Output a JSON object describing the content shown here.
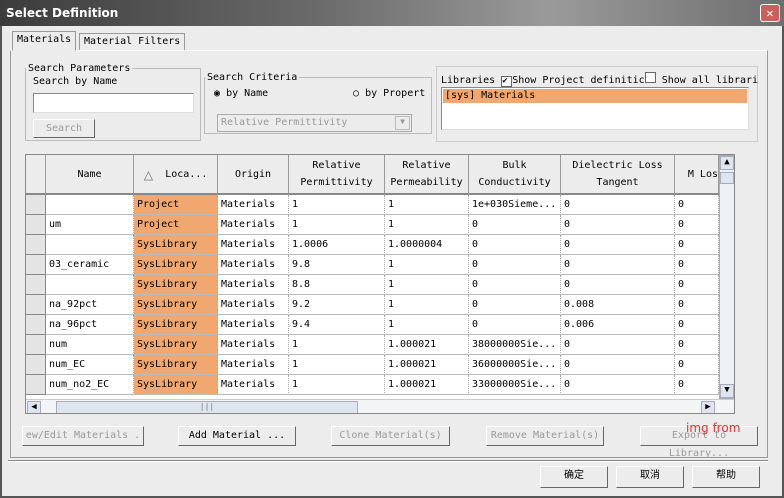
{
  "window": {
    "title": "Select Definition",
    "close_icon": "close-icon"
  },
  "tabs": [
    {
      "label": "Materials",
      "active": true
    },
    {
      "label": "Material Filters",
      "active": false
    }
  ],
  "search_parameters": {
    "legend": "Search Parameters",
    "label": "Search by Name",
    "value": "",
    "button": "Search"
  },
  "search_criteria": {
    "legend": "Search Criteria",
    "by_name": "by Name",
    "by_property": "by Propert",
    "selected": "by Name",
    "property_select": "Relative Permittivity"
  },
  "libraries": {
    "label": "Libraries",
    "show_project": "Show Project definitic",
    "show_project_checked": true,
    "show_all": "Show all librari",
    "show_all_checked": false,
    "items": [
      "[sys] Materials"
    ]
  },
  "table": {
    "columns": [
      "Name",
      "Loca...",
      "Origin",
      "Relative Permittivity",
      "Relative Permeability",
      "Bulk Conductivity",
      "Dielectric Loss Tangent",
      "M Los"
    ],
    "sort_column": "Loca...",
    "rows": [
      [
        "",
        "Project",
        "Materials",
        "1",
        "1",
        "1e+030Sieme...",
        "0",
        "0"
      ],
      [
        "um",
        "Project",
        "Materials",
        "1",
        "1",
        "0",
        "0",
        "0"
      ],
      [
        "",
        "SysLibrary",
        "Materials",
        "1.0006",
        "1.0000004",
        "0",
        "0",
        "0"
      ],
      [
        "03_ceramic",
        "SysLibrary",
        "Materials",
        "9.8",
        "1",
        "0",
        "0",
        "0"
      ],
      [
        "",
        "SysLibrary",
        "Materials",
        "8.8",
        "1",
        "0",
        "0",
        "0"
      ],
      [
        "na_92pct",
        "SysLibrary",
        "Materials",
        "9.2",
        "1",
        "0",
        "0.008",
        "0"
      ],
      [
        "na_96pct",
        "SysLibrary",
        "Materials",
        "9.4",
        "1",
        "0",
        "0.006",
        "0"
      ],
      [
        "num",
        "SysLibrary",
        "Materials",
        "1",
        "1.000021",
        "38000000Sie...",
        "0",
        "0"
      ],
      [
        "num_EC",
        "SysLibrary",
        "Materials",
        "1",
        "1.000021",
        "36000000Sie...",
        "0",
        "0"
      ],
      [
        "num_no2_EC",
        "SysLibrary",
        "Materials",
        "1",
        "1.000021",
        "33000000Sie...",
        "0",
        "0"
      ]
    ]
  },
  "actions": {
    "view_edit": "ew/Edit Materials .",
    "add": "Add Material ...",
    "clone": "Clone Material(s)",
    "remove": "Remove Material(s)",
    "export": "Export to Library..."
  },
  "dialog_buttons": {
    "ok": "确定",
    "cancel": "取消",
    "help": "帮助"
  },
  "watermark": "img from"
}
